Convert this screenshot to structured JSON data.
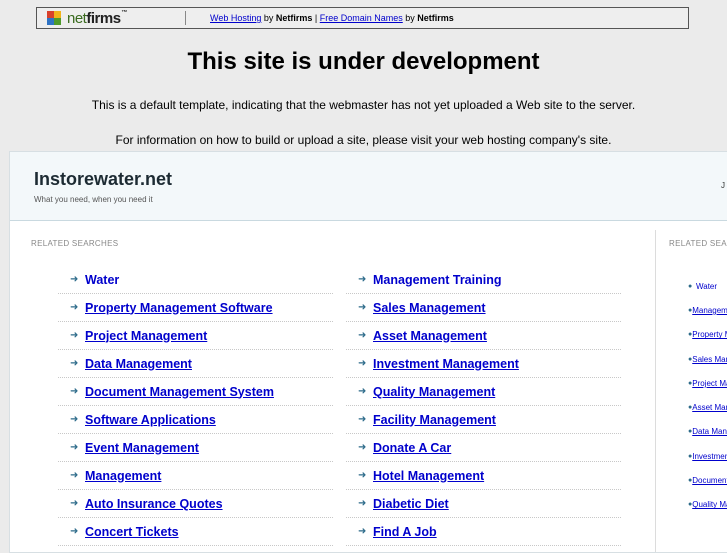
{
  "topbar": {
    "logo_text_net": "net",
    "logo_text_firms": "firms",
    "logo_tm": "™",
    "link_hosting": "Web Hosting",
    "by1": " by ",
    "brand1": "Netfirms",
    "pipe": " | ",
    "link_domains": "Free Domain Names",
    "by2": " by ",
    "brand2": "Netfirms"
  },
  "headline": "This site is under development",
  "line1": "This is a default template, indicating that the webmaster has not yet uploaded a Web site to the server.",
  "line2": "For information on how to build or upload a site, please visit your web hosting company's site.",
  "panel": {
    "site_title": "Instorewater.net",
    "tagline": "What you need, when you need it",
    "header_right": "J",
    "related_label": "RELATED SEARCHES",
    "related_label_right": "RELATED SEARCHES",
    "col1": [
      "Water",
      "Property Management Software",
      "Project Management",
      "Data Management",
      "Document Management System",
      "Software Applications",
      "Event Management",
      "Management",
      "Auto Insurance Quotes",
      "Concert Tickets"
    ],
    "col2": [
      "Management Training",
      "Sales Management",
      "Asset Management",
      "Investment Management",
      "Quality Management",
      "Facility Management",
      "Donate A Car",
      "Hotel Management",
      "Diabetic Diet",
      "Find A Job"
    ],
    "side": [
      "Water",
      "Management Training",
      "Property Management Software",
      "Sales Management",
      "Project Management",
      "Asset Management",
      "Data Management",
      "Investment Management",
      "Document Management System",
      "Quality Management"
    ]
  },
  "colors": {
    "link": "#0000cc",
    "arrow": "#2d6b8a",
    "panel_header": "#f3f8fa"
  },
  "icons": {
    "item_marker": "arrow-right-icon",
    "side_marker": "bullet-icon",
    "logo": "netfirms-logo-icon"
  }
}
